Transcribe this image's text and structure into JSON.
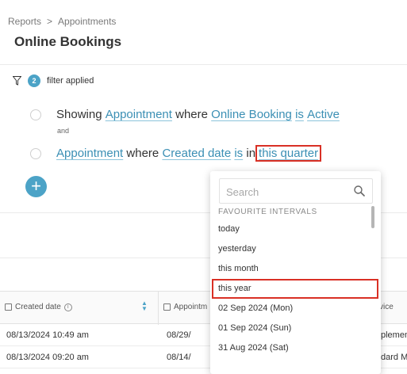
{
  "breadcrumb": {
    "items": [
      "Reports",
      "Appointments"
    ],
    "separator": ">"
  },
  "page": {
    "title": "Online Bookings"
  },
  "filters": {
    "count": "2",
    "label": "filter applied",
    "conditions": [
      {
        "lead": "Showing",
        "entity": "Appointment",
        "where": "where",
        "field": "Online Booking",
        "op": "is",
        "value": "Active"
      },
      {
        "entity": "Appointment",
        "where": "where",
        "field": "Created date",
        "op": "is",
        "in": "in",
        "value": "this quarter"
      }
    ],
    "joiner": "and",
    "add_label": "+"
  },
  "table": {
    "columns": [
      "Created date",
      "Appointm",
      "vice"
    ],
    "rows": [
      [
        "08/13/2024 10:49 am",
        "08/29/",
        "plemen"
      ],
      [
        "08/13/2024 09:20 am",
        "08/14/",
        "dard M"
      ]
    ]
  },
  "dropdown": {
    "search_placeholder": "Search",
    "section_label": "FAVOURITE INTERVALS",
    "options": [
      "today",
      "yesterday",
      "this month",
      "this year",
      "02 Sep 2024 (Mon)",
      "01 Sep 2024 (Sun)",
      "31 Aug 2024 (Sat)"
    ],
    "highlighted": "this year"
  },
  "colors": {
    "accent": "#4ca3c7",
    "link": "#3b8fb4",
    "highlight_box": "#d93025"
  },
  "icons": {
    "filter": "filter-icon",
    "search": "search-icon",
    "calendar": "calendar-icon",
    "info": "info-icon",
    "sort": "sort-icon"
  }
}
